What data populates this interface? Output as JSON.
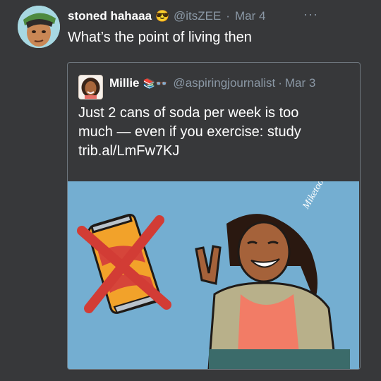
{
  "tweet": {
    "author_name": "stoned hahaaa",
    "author_emoji": "😎",
    "handle": "@itsZEE",
    "separator": "·",
    "date": "Mar 4",
    "more": "···",
    "text": "What’s the point of living then"
  },
  "quoted": {
    "author_name": "Millie",
    "author_emoji": "📚👓",
    "handle": "@aspiringjournalist",
    "separator": "·",
    "date": "Mar 3",
    "text_lines": [
      "Just 2 cans of soda per week is too",
      "much — even if you exercise: study",
      "trib.al/LmFw7KJ"
    ],
    "image": {
      "signature": "Miketoonist",
      "description_icon": "crossed-out-soda-can"
    }
  },
  "colors": {
    "background": "#37383a",
    "muted_text": "#8b98a5",
    "image_sky": "#74aed1"
  }
}
